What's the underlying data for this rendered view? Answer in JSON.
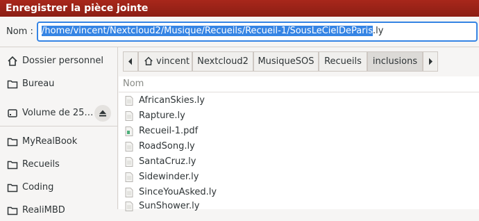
{
  "window": {
    "title": "Enregistrer la pièce jointe"
  },
  "name_field": {
    "label": "Nom :",
    "selected_part": "/home/vincent/Nextcloud2/Musique/Recueils/Recueil-1/SousLeCielDeParis",
    "unselected_part": ".ly"
  },
  "sidebar": {
    "items": [
      {
        "label": "Dossier personnel",
        "icon": "home-icon"
      },
      {
        "label": "Bureau",
        "icon": "folder-icon"
      },
      {
        "label": "Volume de 25…",
        "icon": "drive-icon"
      },
      {
        "label": "MyRealBook",
        "icon": "folder-icon"
      },
      {
        "label": "Recueils",
        "icon": "folder-icon"
      },
      {
        "label": "Coding",
        "icon": "folder-icon"
      },
      {
        "label": "RealiMBD",
        "icon": "folder-icon"
      }
    ]
  },
  "breadcrumb": {
    "items": [
      "vincent",
      "Nextcloud2",
      "MusiqueSOS",
      "Recueils",
      "inclusions"
    ],
    "active": "inclusions"
  },
  "file_list": {
    "column_header": "Nom",
    "files": [
      {
        "name": "AfricanSkies.ly",
        "icon": "text-file-icon"
      },
      {
        "name": "Rapture.ly",
        "icon": "text-file-icon"
      },
      {
        "name": "Recueil-1.pdf",
        "icon": "pdf-file-icon"
      },
      {
        "name": "RoadSong.ly",
        "icon": "text-file-icon"
      },
      {
        "name": "SantaCruz.ly",
        "icon": "text-file-icon"
      },
      {
        "name": "Sidewinder.ly",
        "icon": "text-file-icon"
      },
      {
        "name": "SinceYouAsked.ly",
        "icon": "text-file-icon"
      },
      {
        "name": "SunShower.ly",
        "icon": "text-file-icon"
      }
    ]
  }
}
